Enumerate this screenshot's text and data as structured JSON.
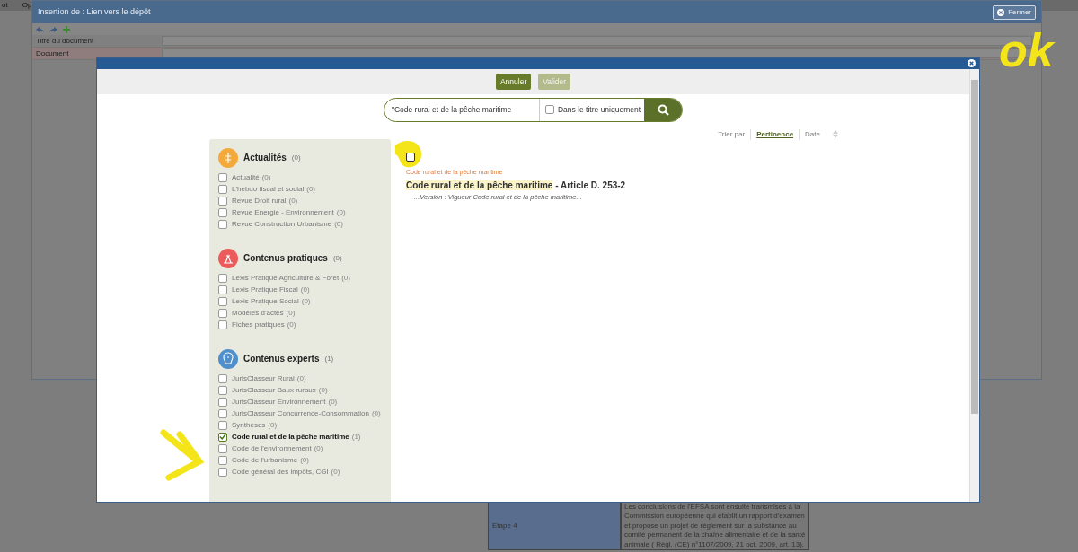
{
  "background_app": {
    "menu": [
      "ot",
      "Op"
    ],
    "table_rows": [
      {
        "step": "Etape 4",
        "text": "Les conclusions de l'EFSA sont ensuite transmises à la Commission européenne qui établit un rapport d'examen et propose un projet de règlement sur la substance au comité permanent de la chaîne alimentaire et de la santé animale ( Règl. (CE) n°1107/2009, 21 oct. 2009, art. 13)."
      }
    ]
  },
  "dialog": {
    "title": "Insertion de : Lien vers le dépôt",
    "close_label": "Fermer",
    "fields": [
      {
        "label": "Titre du document",
        "required": false
      },
      {
        "label": "Document",
        "required": true
      }
    ]
  },
  "modal": {
    "buttons": [
      {
        "label": "Annuler",
        "disabled": false
      },
      {
        "label": "Valider",
        "disabled": true
      }
    ],
    "search": {
      "value": "\"Code rural et de la pêche maritime",
      "title_only": {
        "label": "Dans le titre uniquement",
        "checked": false
      }
    },
    "facets": [
      {
        "title": "Actualités",
        "count": "(0)",
        "color": "#f4a93b",
        "items": [
          {
            "label": "Actualité",
            "count": "(0)",
            "checked": false
          },
          {
            "label": "L'hebdo fiscal et social",
            "count": "(0)",
            "checked": false
          },
          {
            "label": "Revue Droit rural",
            "count": "(0)",
            "checked": false
          },
          {
            "label": "Revue Energie - Environnement",
            "count": "(0)",
            "checked": false
          },
          {
            "label": "Revue Construction Urbanisme",
            "count": "(0)",
            "checked": false
          }
        ]
      },
      {
        "title": "Contenus pratiques",
        "count": "(0)",
        "color": "#ec5b5b",
        "items": [
          {
            "label": "Lexis Pratique Agriculture & Forêt",
            "count": "(0)",
            "checked": false
          },
          {
            "label": "Lexis Pratique Fiscal",
            "count": "(0)",
            "checked": false
          },
          {
            "label": "Lexis Pratique Social",
            "count": "(0)",
            "checked": false
          },
          {
            "label": "Modèles d'actes",
            "count": "(0)",
            "checked": false
          },
          {
            "label": "Fiches pratiques",
            "count": "(0)",
            "checked": false
          }
        ]
      },
      {
        "title": "Contenus experts",
        "count": "(1)",
        "color": "#4f8fcb",
        "items": [
          {
            "label": "JurisClasseur Rural",
            "count": "(0)",
            "checked": false
          },
          {
            "label": "JurisClasseur Baux ruraux",
            "count": "(0)",
            "checked": false
          },
          {
            "label": "JurisClasseur Environnement",
            "count": "(0)",
            "checked": false
          },
          {
            "label": "JurisClasseur Concurrence-Consommation",
            "count": "(0)",
            "checked": false
          },
          {
            "label": "Synthèses",
            "count": "(0)",
            "checked": false
          },
          {
            "label": "Code rural et de la pêche maritime",
            "count": "(1)",
            "checked": true
          },
          {
            "label": "Code de l'environnement",
            "count": "(0)",
            "checked": false
          },
          {
            "label": "Code de l'urbanisme",
            "count": "(0)",
            "checked": false
          },
          {
            "label": "Code général des impôts, CGI",
            "count": "(0)",
            "checked": false
          }
        ]
      }
    ],
    "sort": {
      "label": "Trier par",
      "options": [
        {
          "label": "Pertinence",
          "selected": true
        },
        {
          "label": "Date",
          "selected": false
        }
      ]
    },
    "results": [
      {
        "checked": false,
        "source": "Code rural et de la pêche maritime",
        "title_parts": [
          {
            "text": "Code rural et de la pêche maritime",
            "highlighted": true
          },
          {
            "text": " - Article D. 253-2",
            "highlighted": false
          }
        ],
        "snippet": "...Version : Vigueur  Code rural et de la pêche maritime..."
      }
    ]
  },
  "annotations": [
    {
      "text": "ok"
    }
  ]
}
